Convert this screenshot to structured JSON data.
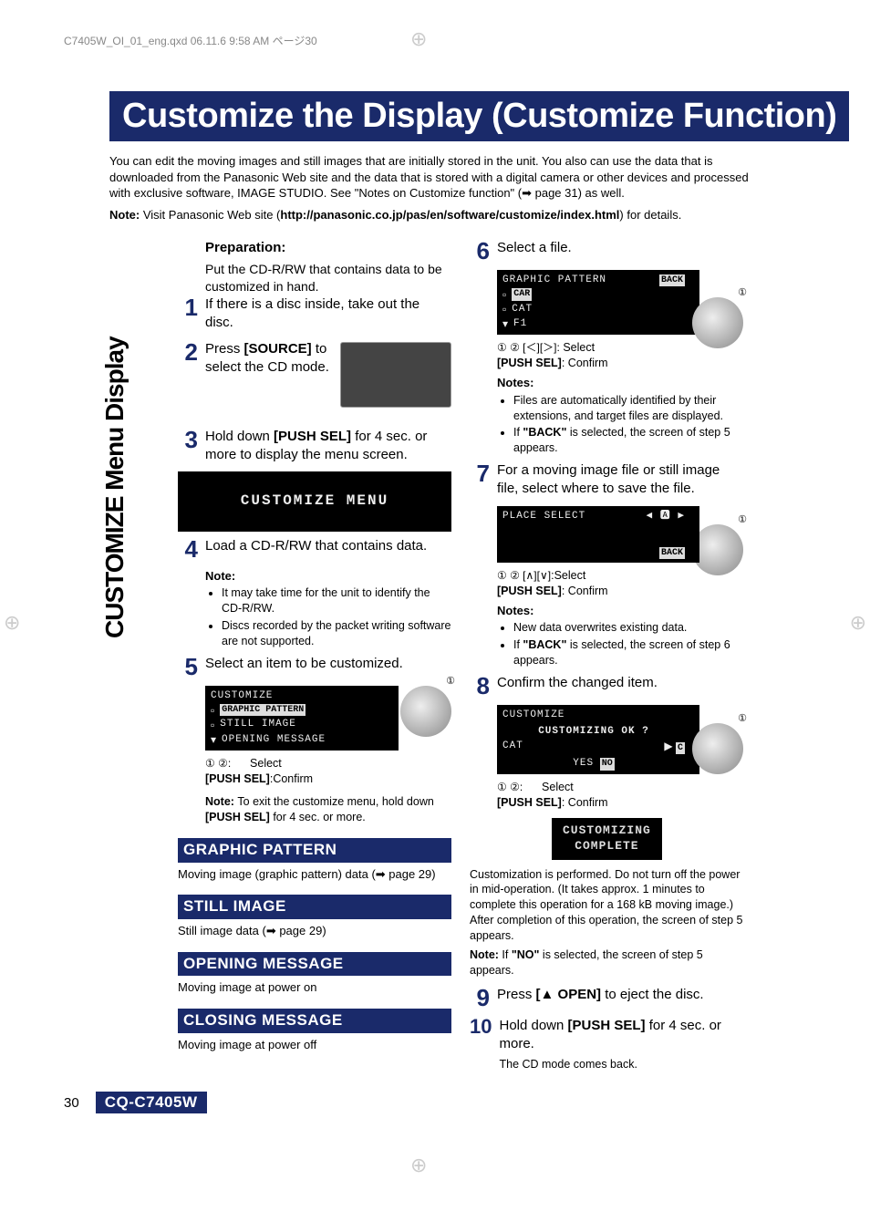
{
  "header_line": "C7405W_OI_01_eng.qxd  06.11.6  9:58 AM  ページ30",
  "title": "Customize the Display (Customize Function)",
  "intro_p1": "You can edit the moving images and still images that are initially stored in the unit. You also can use the data that is downloaded from the Panasonic Web site and the data that is stored with a digital camera or other devices and processed with exclusive software, IMAGE STUDIO. See \"Notes on Customize function\" (➡ page 31) as well.",
  "intro_note_prefix": "Note: ",
  "intro_note_body1": "Visit Panasonic Web site (",
  "intro_note_bold": "http://panasonic.co.jp/pas/en/software/customize/index.html",
  "intro_note_body2": ") for details.",
  "side_label": "CUSTOMIZE Menu Display",
  "preparation_label": "Preparation:",
  "preparation_body": "Put the CD-R/RW that contains data to be customized in hand.",
  "step1": "If there is a disc inside, take out the disc.",
  "step2_a": "Press ",
  "step2_bold": "[SOURCE]",
  "step2_b": " to select the CD mode.",
  "step3_a": "Hold down ",
  "step3_bold": "[PUSH SEL]",
  "step3_b": " for 4 sec. or more to display the menu screen.",
  "customize_menu_display": "CUSTOMIZE MENU",
  "step4": "Load a CD-R/RW that contains data.",
  "step4_note_label": "Note:",
  "step4_bullet1": "It may take time for the unit to identify the CD-R/RW.",
  "step4_bullet2": "Discs recorded by the packet writing software are not supported.",
  "step5": "Select an item to be customized.",
  "step5_menu_title": "CUSTOMIZE",
  "step5_menu_item1": "GRAPHIC PATTERN",
  "step5_menu_item2": "STILL IMAGE",
  "step5_menu_item3": "OPENING MESSAGE",
  "step5_sel_prefix": "① ②:",
  "step5_sel_label": "Select",
  "step5_pushsel": "[PUSH SEL]",
  "step5_confirm": ":Confirm",
  "step5_note_a": "Note: ",
  "step5_note_b": "To exit the customize menu, hold down ",
  "step5_note_bold": "[PUSH SEL]",
  "step5_note_c": " for 4 sec. or more.",
  "sec_gp_head": "GRAPHIC PATTERN",
  "sec_gp_body": "Moving image (graphic pattern) data (➡ page 29)",
  "sec_si_head": "STILL IMAGE",
  "sec_si_body": "Still image data (➡ page 29)",
  "sec_om_head": "OPENING MESSAGE",
  "sec_om_body": "Moving image at power on",
  "sec_cm_head": "CLOSING MESSAGE",
  "sec_cm_body": "Moving image at power off",
  "step6": "Select a file.",
  "step6_menu_title": "GRAPHIC PATTERN",
  "step6_back": "BACK",
  "step6_item1": "CAR",
  "step6_item2": "CAT",
  "step6_item3": "F1",
  "step6_sel_prefix": "① ② [＜][＞]:",
  "step6_sel_label": "Select",
  "step6_pushsel": "[PUSH SEL]",
  "step6_confirm": ": Confirm",
  "step6_notes_label": "Notes:",
  "step6_bullet1": "Files are automatically identified by their extensions, and target files are displayed.",
  "step6_bullet2a": "If ",
  "step6_bullet2bold": "\"BACK\"",
  "step6_bullet2b": " is selected, the screen of step 5 appears.",
  "step7": "For a moving image file or still image file, select where to save the file.",
  "step7_menu_title": "PLACE SELECT",
  "step7_back": "BACK",
  "step7_sel_prefix": "① ② [∧][∨]",
  "step7_sel_label": ":Select",
  "step7_pushsel": "[PUSH SEL]",
  "step7_confirm": ": Confirm",
  "step7_notes_label": "Notes:",
  "step7_bullet1": "New data overwrites existing data.",
  "step7_bullet2a": "If ",
  "step7_bullet2bold": "\"BACK\"",
  "step7_bullet2b": " is selected, the screen of step 6 appears.",
  "step8": "Confirm the changed item.",
  "step8_menu_title": "CUSTOMIZE",
  "step8_prompt": "CUSTOMIZING OK ?",
  "step8_item": "CAT",
  "step8_yes": "YES",
  "step8_no": "NO",
  "step8_sel_prefix": "① ②:",
  "step8_sel_label": "Select",
  "step8_pushsel": "[PUSH SEL]",
  "step8_confirm": ": Confirm",
  "step8_complete": "CUSTOMIZING COMPLETE",
  "step8_para": "Customization is performed. Do not turn off the power in mid-operation. (It takes approx. 1 minutes to complete this operation for a 168 kB moving image.) After completion of this operation, the screen of step 5 appears.",
  "step8_note_a": "Note: ",
  "step8_note_b": "If ",
  "step8_note_bold": "\"NO\"",
  "step8_note_c": " is selected, the screen of step 5 appears.",
  "step9_a": "Press ",
  "step9_bold": "[▲ OPEN]",
  "step9_b": " to eject the disc.",
  "step10_a": "Hold down ",
  "step10_bold": "[PUSH SEL]",
  "step10_b": " for 4 sec. or more.",
  "step10_c": "The CD mode comes back.",
  "pagenum": "30",
  "model": "CQ-C7405W"
}
